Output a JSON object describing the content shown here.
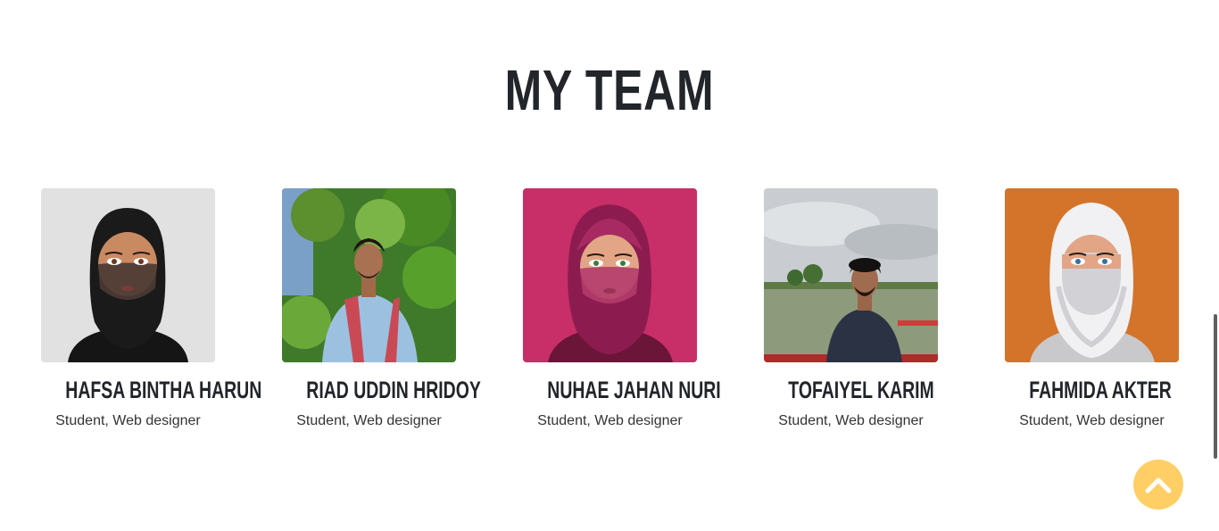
{
  "section": {
    "title": "MY TEAM"
  },
  "team": [
    {
      "name": "HAFSA BINTHA HARUN",
      "role": "Student, Web designer",
      "icon": "hijab-avatar-black"
    },
    {
      "name": "RIAD UDDIN HRIDOY",
      "role": "Student, Web designer",
      "icon": "photo-man-forest"
    },
    {
      "name": "NUHAE JAHAN NURI",
      "role": "Student, Web designer",
      "icon": "hijab-avatar-magenta"
    },
    {
      "name": "TOFAIYEL KARIM",
      "role": "Student, Web designer",
      "icon": "photo-man-boat"
    },
    {
      "name": "FAHMIDA AKTER",
      "role": "Student, Web designer",
      "icon": "hijab-avatar-white"
    }
  ],
  "colors": {
    "heading": "#22252a",
    "scroll_button": "#ffcf66"
  },
  "scroll_top": {
    "icon": "chevron-up-icon"
  }
}
